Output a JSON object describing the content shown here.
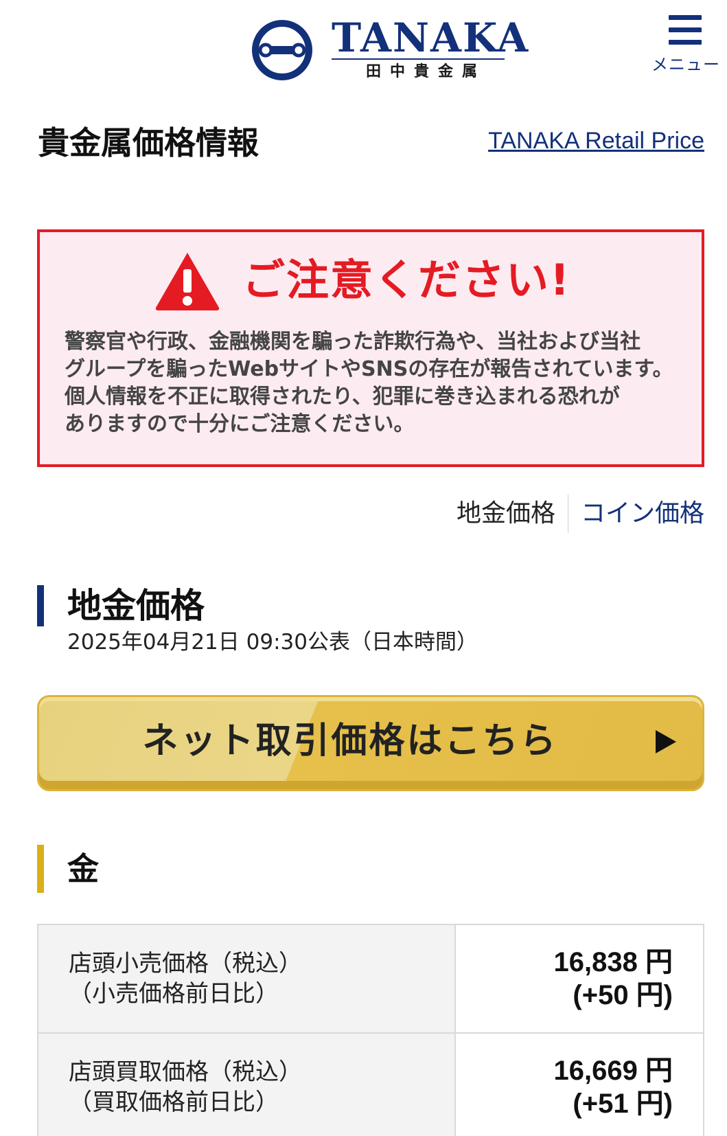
{
  "header": {
    "logo_word": "TANAKA",
    "logo_jp": "田中貴金属",
    "menu_label": "メニュー",
    "colors": {
      "brand_navy": "#13307a"
    }
  },
  "page": {
    "title": "貴金属価格情報",
    "retail_link": "TANAKA Retail Price"
  },
  "warning": {
    "title": "ご注意ください!",
    "icon": "warning-triangle-icon",
    "lines": [
      "警察官や行政、金融機関を騙った詐欺行為や、当社および当社",
      "グループを騙ったWebサイトやSNSの存在が報告されています。",
      "個人情報を不正に取得されたり、犯罪に巻き込まれる恐れが",
      "ありますので十分にご注意ください。"
    ],
    "colors": {
      "border": "#e41b23",
      "background": "#fcebf1"
    }
  },
  "tabs": [
    {
      "label": "地金価格",
      "active": true
    },
    {
      "label": "コイン価格",
      "active": false
    }
  ],
  "section": {
    "title": "地金価格",
    "published": "2025年04月21日 09:30公表（日本時間）"
  },
  "net_button": {
    "label": "ネット取引価格はこちら",
    "arrow_icon": "play-arrow-icon"
  },
  "gold": {
    "title": "金",
    "rows": [
      {
        "label_line1": "店頭小売価格（税込）",
        "label_line2": "（小売価格前日比）",
        "value": "16,838 円",
        "change": "(+50 円)"
      },
      {
        "label_line1": "店頭買取価格（税込）",
        "label_line2": "（買取価格前日比）",
        "value": "16,669 円",
        "change": "(+51 円)"
      }
    ]
  }
}
